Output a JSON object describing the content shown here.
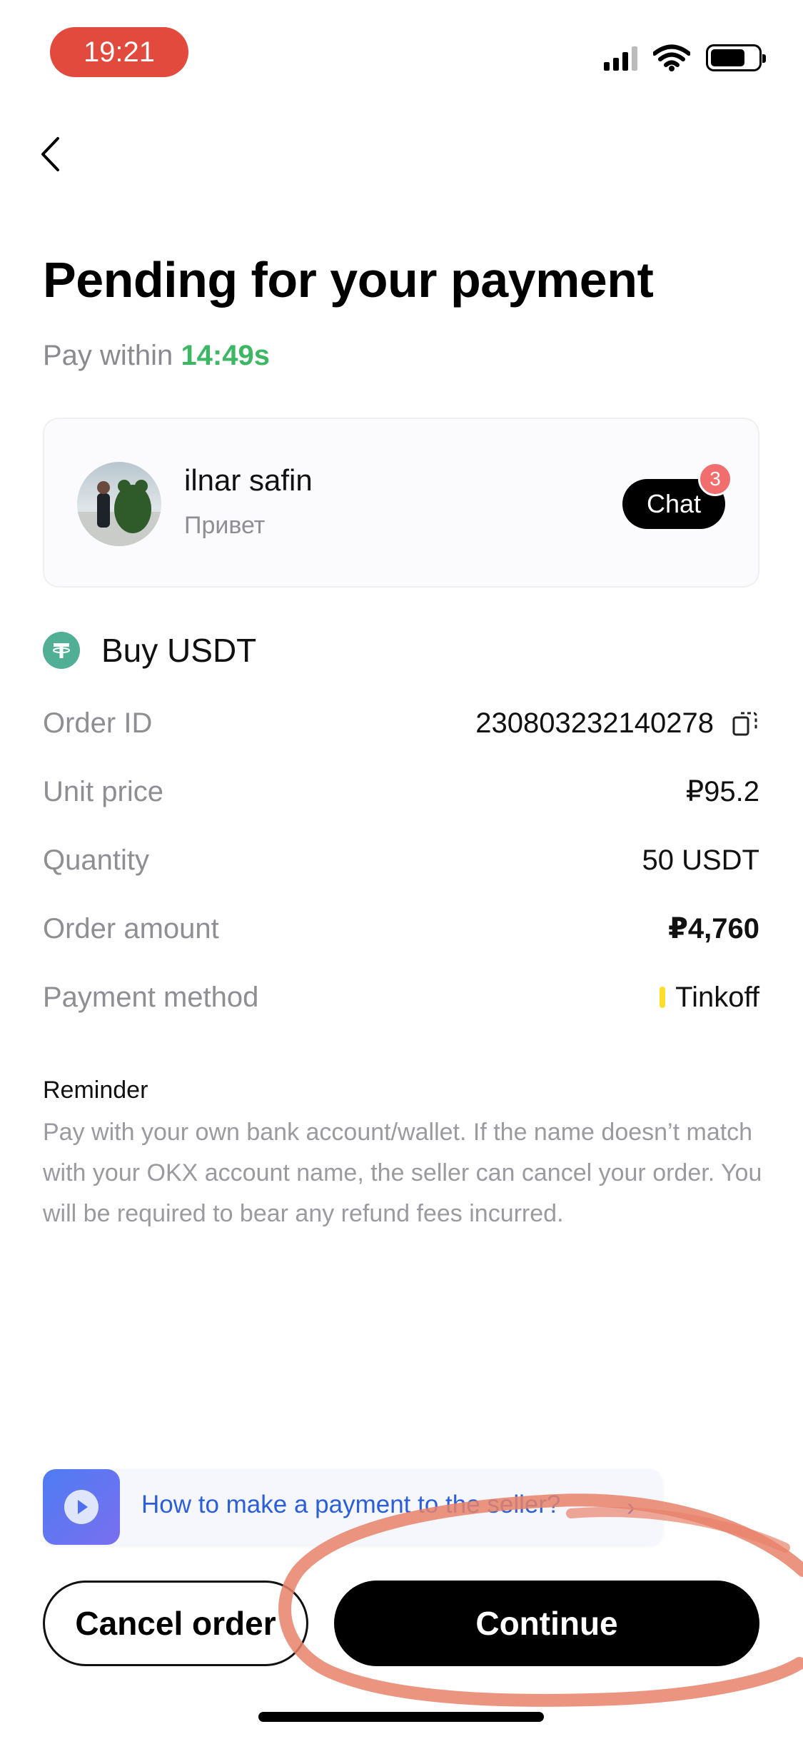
{
  "status_bar": {
    "time": "19:21",
    "icons": [
      "signal-icon",
      "wifi-icon",
      "battery-icon"
    ]
  },
  "header": {
    "back_icon": "chevron-left-icon",
    "title": "Pending for your payment",
    "pay_within_label": "Pay within",
    "countdown": "14:49s",
    "countdown_color": "#3cb764"
  },
  "seller": {
    "name": "ilnar safin",
    "status": "Привет",
    "chat_label": "Chat",
    "unread_count": "3"
  },
  "order": {
    "title": "Buy USDT",
    "rows": [
      {
        "label": "Order ID",
        "value": "230803232140278"
      },
      {
        "label": "Unit price",
        "value": "₽95.2"
      },
      {
        "label": "Quantity",
        "value": "50 USDT"
      },
      {
        "label": "Order amount",
        "value": "₽4,760"
      },
      {
        "label": "Payment method",
        "value": "Tinkoff"
      }
    ]
  },
  "reminder": {
    "title": "Reminder",
    "text": "Pay with your own bank account/wallet. If the name doesn’t match with your OKX account name, the seller can cancel your order. You will be required to bear any refund fees incurred."
  },
  "help": {
    "label": "How to make a payment to the seller?",
    "chevron": "›"
  },
  "actions": {
    "cancel_label": "Cancel order",
    "continue_label": "Continue"
  },
  "colors": {
    "accent_green": "#3cb764",
    "annotation_red": "#e8826a",
    "link_blue": "#2a5fd9",
    "usdt_green": "#50af95",
    "tinkoff_yellow": "#ffdd2d"
  }
}
